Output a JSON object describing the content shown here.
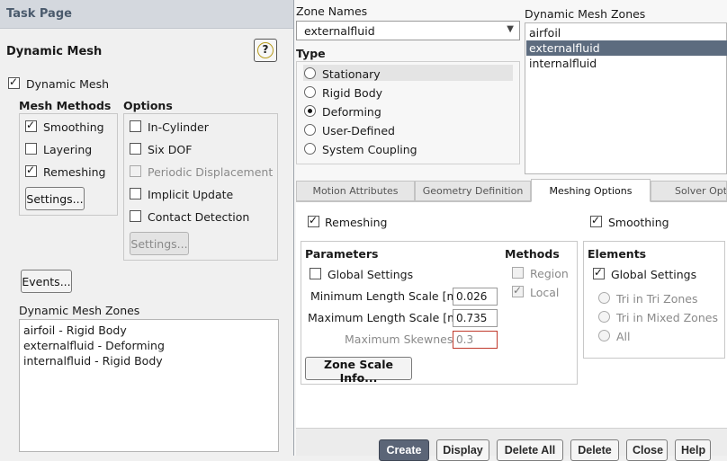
{
  "task_page": {
    "header": "Task Page",
    "title": "Dynamic Mesh",
    "help_label": "?",
    "dynamic_mesh_checkbox": "Dynamic Mesh",
    "mesh_methods": {
      "title": "Mesh Methods",
      "items": [
        {
          "label": "Smoothing",
          "checked": true
        },
        {
          "label": "Layering",
          "checked": false
        },
        {
          "label": "Remeshing",
          "checked": true
        }
      ],
      "settings_button": "Settings..."
    },
    "options": {
      "title": "Options",
      "items": [
        {
          "label": "In-Cylinder",
          "checked": false,
          "enabled": true
        },
        {
          "label": "Six DOF",
          "checked": false,
          "enabled": true
        },
        {
          "label": "Periodic Displacement",
          "checked": false,
          "enabled": false
        },
        {
          "label": "Implicit Update",
          "checked": false,
          "enabled": true
        },
        {
          "label": "Contact Detection",
          "checked": false,
          "enabled": true
        }
      ],
      "settings_button": "Settings..."
    },
    "events_button": "Events...",
    "zones_list": {
      "title": "Dynamic Mesh Zones",
      "items": [
        "airfoil - Rigid Body",
        "externalfluid - Deforming",
        "internalfluid - Rigid Body"
      ]
    }
  },
  "zone_panel": {
    "zone_names_label": "Zone Names",
    "zone_names_value": "externalfluid",
    "type": {
      "title": "Type",
      "options": [
        {
          "label": "Stationary",
          "checked": false
        },
        {
          "label": "Rigid Body",
          "checked": false
        },
        {
          "label": "Deforming",
          "checked": true
        },
        {
          "label": "User-Defined",
          "checked": false
        },
        {
          "label": "System Coupling",
          "checked": false
        }
      ]
    },
    "zones_list": {
      "title": "Dynamic Mesh Zones",
      "items": [
        "airfoil",
        "externalfluid",
        "internalfluid"
      ],
      "selected": "externalfluid"
    },
    "tabs": [
      "Motion Attributes",
      "Geometry Definition",
      "Meshing Options",
      "Solver Optio"
    ],
    "active_tab": "Meshing Options",
    "meshing": {
      "remeshing_label": "Remeshing",
      "smoothing_label": "Smoothing",
      "parameters": {
        "title": "Parameters",
        "global_settings": "Global Settings",
        "min_length_label": "Minimum Length Scale [m]",
        "min_length_value": "0.026",
        "max_length_label": "Maximum Length Scale [m]",
        "max_length_value": "0.735",
        "max_skewness_label": "Maximum Skewness",
        "max_skewness_value": "0.3",
        "zone_scale_button": "Zone Scale Info..."
      },
      "methods": {
        "title": "Methods",
        "region": "Region",
        "local": "Local"
      },
      "elements": {
        "title": "Elements",
        "global_settings": "Global Settings",
        "options": [
          "Tri in Tri Zones",
          "Tri in Mixed Zones",
          "All"
        ]
      }
    },
    "buttons": {
      "create": "Create",
      "display": "Display",
      "delete_all": "Delete All",
      "delete": "Delete",
      "close": "Close",
      "help": "Help"
    }
  },
  "colors": {
    "header_bg": "#d4d8de",
    "header_text": "#4a5a6c",
    "selection_bg": "#5d6c7f",
    "primary_button": "#5b6577",
    "invalid_border": "#c0392b"
  }
}
